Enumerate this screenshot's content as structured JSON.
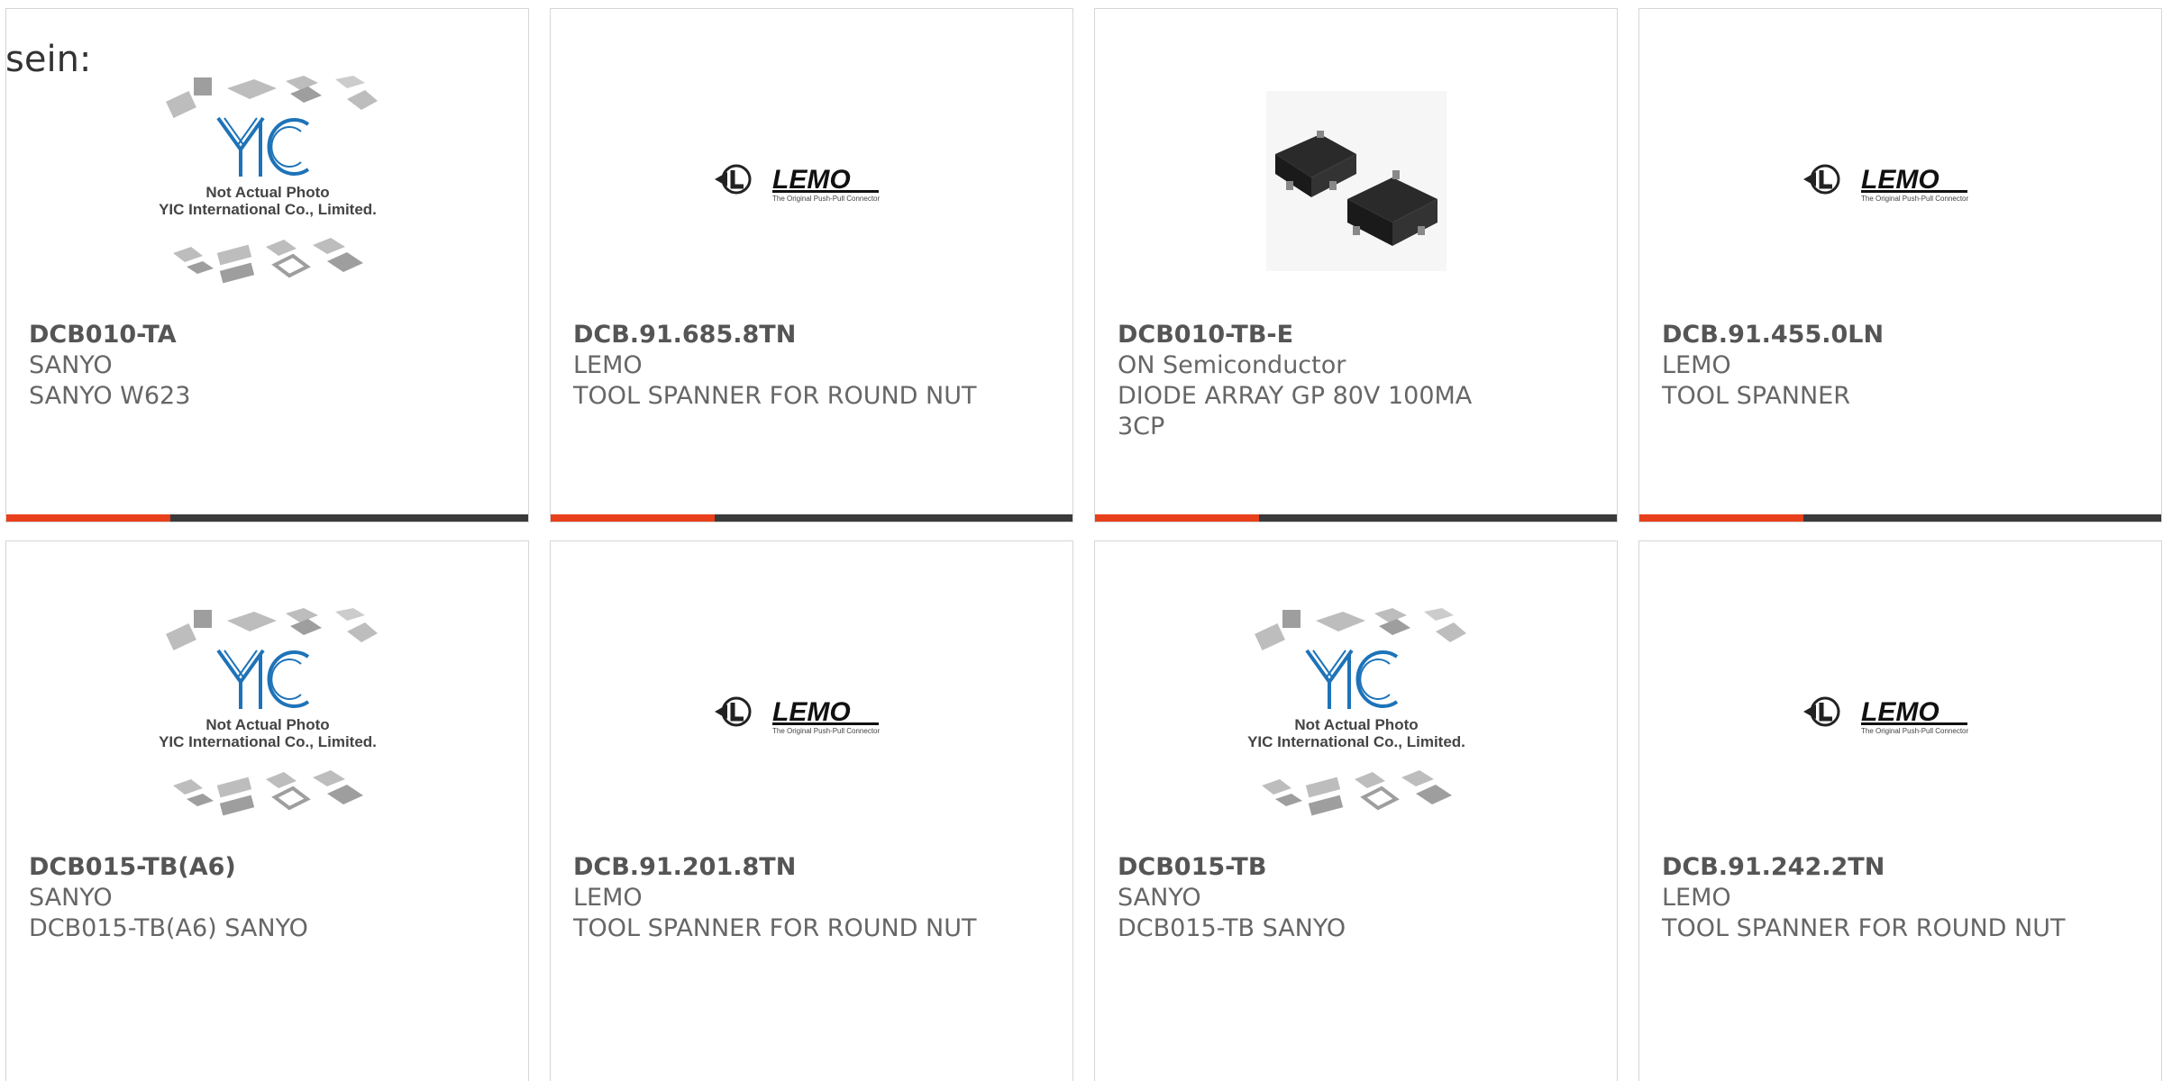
{
  "intro_text": "sein:",
  "theme": {
    "accent": "#e8401c",
    "bar": "#3a3a3a",
    "yic_blue": "#1e73b8"
  },
  "placeholder": {
    "line1": "Not Actual Photo",
    "line2": "YIC International Co., Limited."
  },
  "lemo": {
    "wordmark": "LEMO",
    "tagline": "The Original Push-Pull Connector"
  },
  "products": [
    {
      "part": "DCB010-TA",
      "maker": "SANYO",
      "desc": "SANYO W623",
      "image": "yic-placeholder-icon"
    },
    {
      "part": "DCB.91.685.8TN",
      "maker": "LEMO",
      "desc": "TOOL SPANNER FOR ROUND NUT",
      "image": "lemo-logo-icon"
    },
    {
      "part": "DCB010-TB-E",
      "maker": "ON Semiconductor",
      "desc": "DIODE ARRAY GP 80V 100MA 3CP",
      "image": "sot23-chip-icon"
    },
    {
      "part": "DCB.91.455.0LN",
      "maker": "LEMO",
      "desc": "TOOL SPANNER",
      "image": "lemo-logo-icon"
    },
    {
      "part": "DCB015-TB(A6)",
      "maker": "SANYO",
      "desc": "DCB015-TB(A6) SANYO",
      "image": "yic-placeholder-icon"
    },
    {
      "part": "DCB.91.201.8TN",
      "maker": "LEMO",
      "desc": "TOOL SPANNER FOR ROUND NUT",
      "image": "lemo-logo-icon"
    },
    {
      "part": "DCB015-TB",
      "maker": "SANYO",
      "desc": "DCB015-TB SANYO",
      "image": "yic-placeholder-icon"
    },
    {
      "part": "DCB.91.242.2TN",
      "maker": "LEMO",
      "desc": "TOOL SPANNER FOR ROUND NUT",
      "image": "lemo-logo-icon"
    }
  ]
}
